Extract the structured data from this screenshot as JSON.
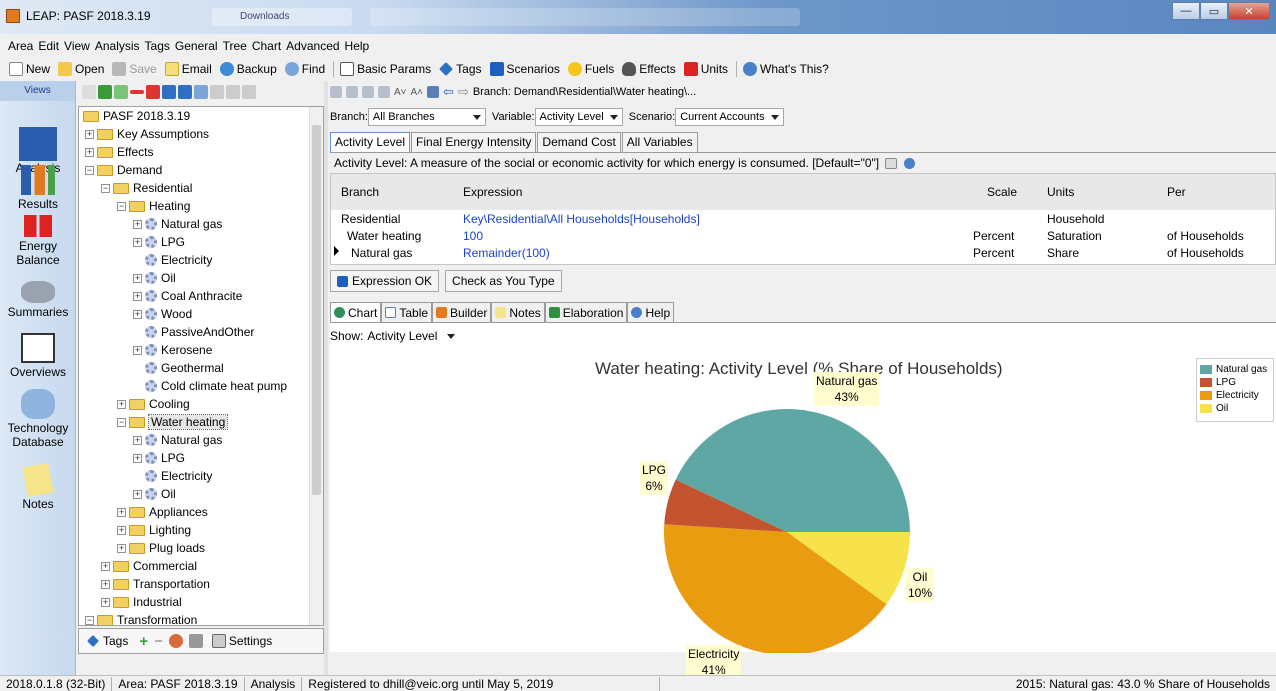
{
  "window": {
    "title": "LEAP: PASF 2018.3.19",
    "tab2": "Downloads"
  },
  "menu": [
    "Area",
    "Edit",
    "View",
    "Analysis",
    "Tags",
    "General",
    "Tree",
    "Chart",
    "Advanced",
    "Help"
  ],
  "toolbar": {
    "new": "New",
    "open": "Open",
    "save": "Save",
    "email": "Email",
    "backup": "Backup",
    "find": "Find",
    "basic_params": "Basic Params",
    "tags": "Tags",
    "scenarios": "Scenarios",
    "fuels": "Fuels",
    "effects": "Effects",
    "units": "Units",
    "whats_this": "What's This?"
  },
  "views": {
    "title": "Views",
    "items": [
      "Analysis",
      "Results",
      "Energy Balance",
      "Summaries",
      "Overviews",
      "Technology Database",
      "Notes"
    ]
  },
  "tree": {
    "root": "PASF 2018.3.19",
    "nodes": [
      "Key Assumptions",
      "Effects",
      "Demand",
      "Residential",
      "Heating",
      "Natural gas",
      "LPG",
      "Electricity",
      "Oil",
      "Coal Anthracite",
      "Wood",
      "PassiveAndOther",
      "Kerosene",
      "Geothermal",
      "Cold climate heat pump",
      "Cooling",
      "Water heating",
      "Natural gas",
      "LPG",
      "Electricity",
      "Oil",
      "Appliances",
      "Lighting",
      "Plug loads",
      "Commercial",
      "Transportation",
      "Industrial",
      "Transformation"
    ],
    "footer": {
      "tags": "Tags",
      "settings": "Settings"
    }
  },
  "breadcrumb": "Branch: Demand\\Residential\\Water heating\\...",
  "selectors": {
    "branch_label": "Branch:",
    "branch_value": "All Branches",
    "variable_label": "Variable:",
    "variable_value": "Activity Level",
    "scenario_label": "Scenario:",
    "scenario_value": "Current Accounts"
  },
  "tabs": [
    "Activity Level",
    "Final Energy Intensity",
    "Demand Cost",
    "All Variables"
  ],
  "description": "Activity Level: A measure of the social or economic activity for which energy is consumed. [Default=\"0\"]",
  "grid": {
    "headers": {
      "branch": "Branch",
      "expression": "Expression",
      "scale": "Scale",
      "units": "Units",
      "per": "Per"
    },
    "rows": [
      {
        "branch": "Residential",
        "expression": "Key\\Residential\\All Households[Households]",
        "scale": "",
        "units": "Household",
        "per": ""
      },
      {
        "branch": "Water heating",
        "expression": "100",
        "scale": "Percent",
        "units": "Saturation",
        "per": "of Households"
      },
      {
        "branch": "Natural gas",
        "expression": "Remainder(100)",
        "scale": "Percent",
        "units": "Share",
        "per": "of Households"
      }
    ]
  },
  "expression_bar": {
    "ok": "Expression OK",
    "check": "Check as You Type"
  },
  "subtabs": [
    "Chart",
    "Table",
    "Builder",
    "Notes",
    "Elaboration",
    "Help"
  ],
  "show": {
    "label": "Show:",
    "value": "Activity Level"
  },
  "colors": {
    "natural_gas": "#5fa7a5",
    "lpg": "#c4532f",
    "electricity": "#e99c0f",
    "oil": "#f7e24b"
  },
  "chart_data": {
    "type": "pie",
    "title": "Water heating: Activity Level (% Share of Households)",
    "categories": [
      "Natural gas",
      "LPG",
      "Electricity",
      "Oil"
    ],
    "values": [
      43,
      6,
      41,
      10
    ],
    "labels": [
      "43%",
      "6%",
      "41%",
      "10%"
    ],
    "legend": "top-right"
  },
  "status": {
    "version": "2018.0.1.8 (32-Bit)",
    "area": "Area: PASF 2018.3.19",
    "view": "Analysis",
    "registered": "Registered to dhill@veic.org until May 5, 2019",
    "info": "2015: Natural gas: 43.0 % Share of Households"
  }
}
